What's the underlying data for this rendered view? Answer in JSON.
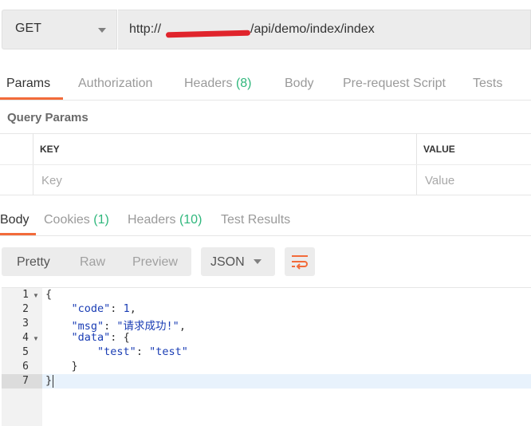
{
  "request": {
    "method": "GET",
    "url_prefix": "http://",
    "url_suffix": "/api/demo/index/index"
  },
  "request_tabs": {
    "params": "Params",
    "authorization": "Authorization",
    "headers": "Headers",
    "headers_count": "(8)",
    "body": "Body",
    "prerequest": "Pre-request Script",
    "tests": "Tests"
  },
  "query_params": {
    "title": "Query Params",
    "key_header": "KEY",
    "value_header": "VALUE",
    "key_placeholder": "Key",
    "value_placeholder": "Value"
  },
  "response_tabs": {
    "body": "Body",
    "cookies": "Cookies",
    "cookies_count": "(1)",
    "headers": "Headers",
    "headers_count": "(10)",
    "test_results": "Test Results"
  },
  "response_toolbar": {
    "pretty": "Pretty",
    "raw": "Raw",
    "preview": "Preview",
    "format": "JSON",
    "wrap_icon": "wrap-lines-icon"
  },
  "response_body": {
    "line_numbers": [
      "1",
      "2",
      "3",
      "4",
      "5",
      "6",
      "7"
    ],
    "open_brace": "{",
    "code_key": "\"code\"",
    "code_value": "1",
    "msg_key": "\"msg\"",
    "msg_value": "\"请求成功!\"",
    "data_key": "\"data\"",
    "data_open": "{",
    "test_key": "\"test\"",
    "test_value": "\"test\"",
    "data_close": "}",
    "close_brace": "}"
  },
  "colors": {
    "accent": "#f26b3a",
    "count_green": "#2fb77c",
    "json_blue": "#1a3db4"
  }
}
